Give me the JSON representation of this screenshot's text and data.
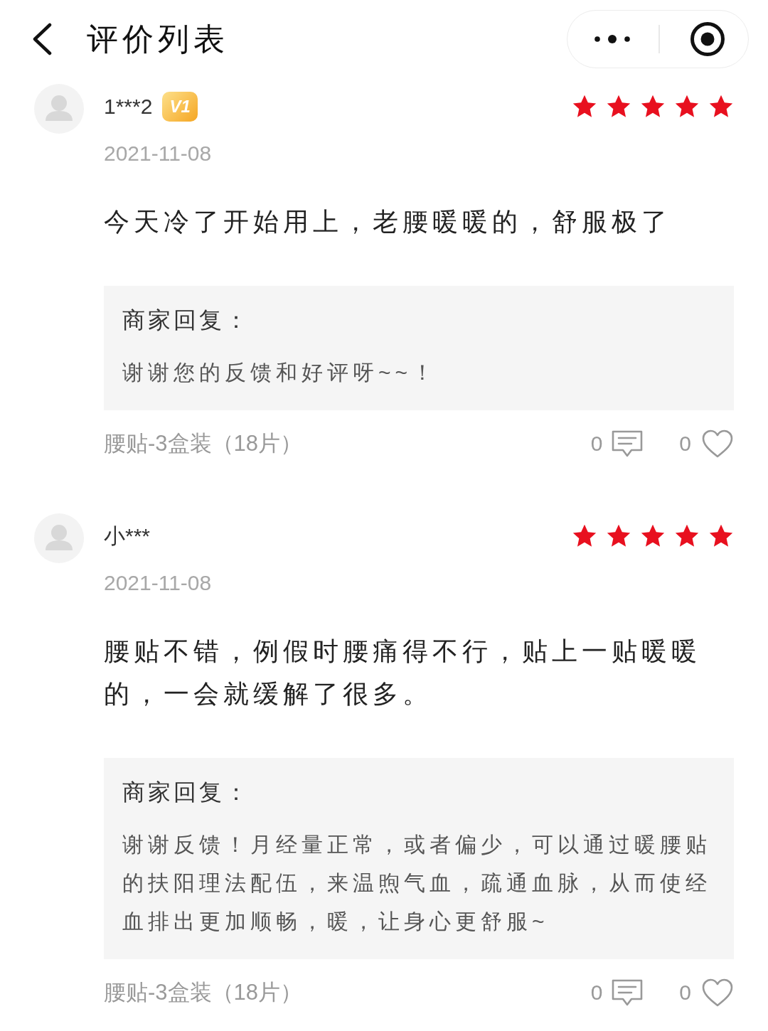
{
  "header": {
    "title": "评价列表"
  },
  "reviews": [
    {
      "user": {
        "name": "1***2",
        "level": "V1"
      },
      "stars": 5,
      "date": "2021-11-08",
      "content": "今天冷了开始用上，老腰暖暖的，舒服极了",
      "reply": {
        "label": "商家回复：",
        "text": "谢谢您的反馈和好评呀~~！"
      },
      "product": "腰贴-3盒装（18片）",
      "comments": "0",
      "likes": "0"
    },
    {
      "user": {
        "name": "小***"
      },
      "stars": 5,
      "date": "2021-11-08",
      "content": "腰贴不错，例假时腰痛得不行，贴上一贴暖暖的，一会就缓解了很多。",
      "reply": {
        "label": "商家回复：",
        "text": "谢谢反馈！月经量正常，或者偏少，可以通过暖腰贴的扶阳理法配伍，来温煦气血，疏通血脉，从而使经血排出更加顺畅，暖，让身心更舒服~"
      },
      "product": "腰贴-3盒装（18片）",
      "comments": "0",
      "likes": "0"
    }
  ]
}
